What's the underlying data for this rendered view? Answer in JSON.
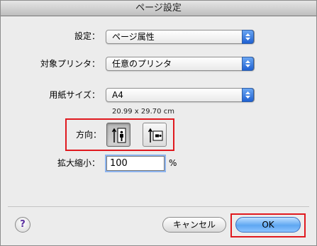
{
  "window": {
    "title": "ページ設定"
  },
  "settings": {
    "label": "設定：",
    "value": "ページ属性"
  },
  "printer": {
    "label": "対象プリンタ：",
    "value": "任意のプリンタ"
  },
  "paper": {
    "label": "用紙サイズ：",
    "value": "A4",
    "dimensions": "20.99 x 29.70 cm"
  },
  "orientation": {
    "label": "方向：",
    "selected": "portrait",
    "options": [
      "portrait",
      "landscape"
    ]
  },
  "scale": {
    "label": "拡大縮小：",
    "value": "100",
    "unit": "%"
  },
  "buttons": {
    "help": "?",
    "cancel": "キャンセル",
    "ok": "OK"
  },
  "colors": {
    "highlight": "#e0191f",
    "accent": "#1f61d3"
  }
}
